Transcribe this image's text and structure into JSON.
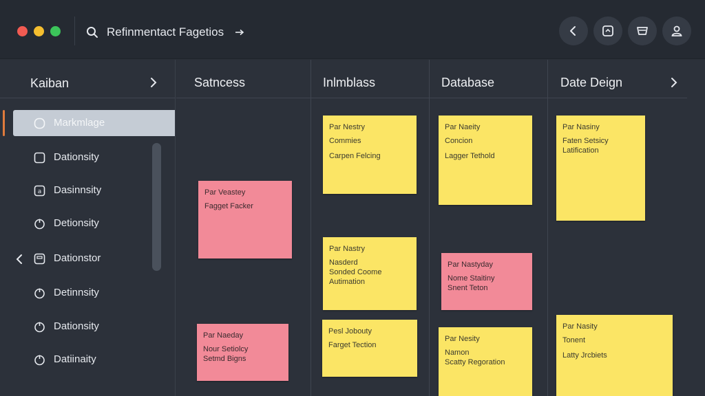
{
  "titlebar": {
    "search_text": "Refinmentact Fagetios",
    "buttons": [
      "back-icon",
      "badge-icon",
      "basket-icon",
      "user-icon"
    ]
  },
  "colors": {
    "background": "#2c313a",
    "titlebar": "#252a32",
    "yellow_card": "#fbe565",
    "pink_card": "#f28a98",
    "accent": "#e07b3c"
  },
  "sidebar": {
    "title": "Kaiban",
    "items": [
      {
        "label": "Markmlage",
        "icon": "circle-icon",
        "active": true
      },
      {
        "label": "Dationsity",
        "icon": "square-icon"
      },
      {
        "label": "Dasinnsity",
        "icon": "app-icon"
      },
      {
        "label": "Detionsity",
        "icon": "power-icon"
      },
      {
        "label": "Dationstor",
        "icon": "save-icon"
      },
      {
        "label": "Detinnsity",
        "icon": "power-icon"
      },
      {
        "label": "Dationsity",
        "icon": "power-icon"
      },
      {
        "label": "Datiinaity",
        "icon": "power-icon"
      }
    ]
  },
  "board": {
    "columns": [
      {
        "title": "Satncess",
        "cards": [
          {
            "color": "pink",
            "title": "Par Veastey",
            "line2": "Fagget Facker",
            "line3": ""
          },
          {
            "color": "pink",
            "title": "Par Naeday",
            "line2": "Nour Setiolcy\nSetmd Bigns",
            "line3": ""
          }
        ]
      },
      {
        "title": "Inlmblass",
        "cards": [
          {
            "color": "yellow",
            "title": "Par Nestry",
            "line2": "Commies",
            "line3": "Carpen Felcing"
          },
          {
            "color": "yellow",
            "title": "Par Nastry",
            "line2": "Nasderd\nSonded Coome\nAutimation",
            "line3": ""
          },
          {
            "color": "yellow",
            "title": "Pesl Jobouty",
            "line2": "Farget Tection",
            "line3": ""
          }
        ]
      },
      {
        "title": "Database",
        "cards": [
          {
            "color": "yellow",
            "title": "Par Naeity",
            "line2": "Concion",
            "line3": "Lagger Tethold"
          },
          {
            "color": "pink",
            "title": "Par Nastyday",
            "line2": "Nome Staitiny\nSnent Teton",
            "line3": ""
          },
          {
            "color": "yellow",
            "title": "Par Nesity",
            "line2": "Namon\nScatty Regoration",
            "line3": ""
          }
        ]
      },
      {
        "title": "Date Deign",
        "cards": [
          {
            "color": "yellow",
            "title": "Par Nasiny",
            "line2": "Faten Setsicy\nLatification",
            "line3": ""
          },
          {
            "color": "yellow",
            "title": "Par Nasity",
            "line2": "Tonent",
            "line3": "Latty Jrcbiets"
          }
        ]
      }
    ]
  }
}
